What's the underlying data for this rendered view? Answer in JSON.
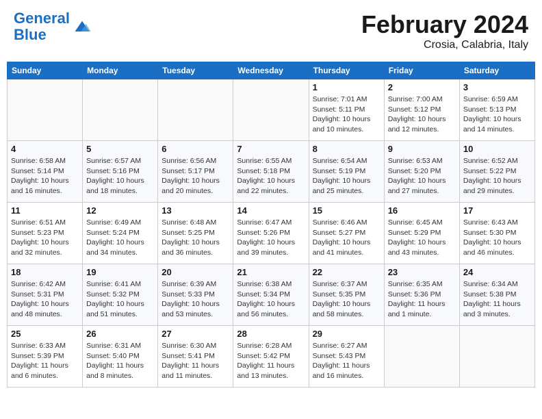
{
  "header": {
    "logo_line1": "General",
    "logo_line2": "Blue",
    "month": "February 2024",
    "location": "Crosia, Calabria, Italy"
  },
  "days_of_week": [
    "Sunday",
    "Monday",
    "Tuesday",
    "Wednesday",
    "Thursday",
    "Friday",
    "Saturday"
  ],
  "weeks": [
    [
      {
        "day": "",
        "info": ""
      },
      {
        "day": "",
        "info": ""
      },
      {
        "day": "",
        "info": ""
      },
      {
        "day": "",
        "info": ""
      },
      {
        "day": "1",
        "info": "Sunrise: 7:01 AM\nSunset: 5:11 PM\nDaylight: 10 hours\nand 10 minutes."
      },
      {
        "day": "2",
        "info": "Sunrise: 7:00 AM\nSunset: 5:12 PM\nDaylight: 10 hours\nand 12 minutes."
      },
      {
        "day": "3",
        "info": "Sunrise: 6:59 AM\nSunset: 5:13 PM\nDaylight: 10 hours\nand 14 minutes."
      }
    ],
    [
      {
        "day": "4",
        "info": "Sunrise: 6:58 AM\nSunset: 5:14 PM\nDaylight: 10 hours\nand 16 minutes."
      },
      {
        "day": "5",
        "info": "Sunrise: 6:57 AM\nSunset: 5:16 PM\nDaylight: 10 hours\nand 18 minutes."
      },
      {
        "day": "6",
        "info": "Sunrise: 6:56 AM\nSunset: 5:17 PM\nDaylight: 10 hours\nand 20 minutes."
      },
      {
        "day": "7",
        "info": "Sunrise: 6:55 AM\nSunset: 5:18 PM\nDaylight: 10 hours\nand 22 minutes."
      },
      {
        "day": "8",
        "info": "Sunrise: 6:54 AM\nSunset: 5:19 PM\nDaylight: 10 hours\nand 25 minutes."
      },
      {
        "day": "9",
        "info": "Sunrise: 6:53 AM\nSunset: 5:20 PM\nDaylight: 10 hours\nand 27 minutes."
      },
      {
        "day": "10",
        "info": "Sunrise: 6:52 AM\nSunset: 5:22 PM\nDaylight: 10 hours\nand 29 minutes."
      }
    ],
    [
      {
        "day": "11",
        "info": "Sunrise: 6:51 AM\nSunset: 5:23 PM\nDaylight: 10 hours\nand 32 minutes."
      },
      {
        "day": "12",
        "info": "Sunrise: 6:49 AM\nSunset: 5:24 PM\nDaylight: 10 hours\nand 34 minutes."
      },
      {
        "day": "13",
        "info": "Sunrise: 6:48 AM\nSunset: 5:25 PM\nDaylight: 10 hours\nand 36 minutes."
      },
      {
        "day": "14",
        "info": "Sunrise: 6:47 AM\nSunset: 5:26 PM\nDaylight: 10 hours\nand 39 minutes."
      },
      {
        "day": "15",
        "info": "Sunrise: 6:46 AM\nSunset: 5:27 PM\nDaylight: 10 hours\nand 41 minutes."
      },
      {
        "day": "16",
        "info": "Sunrise: 6:45 AM\nSunset: 5:29 PM\nDaylight: 10 hours\nand 43 minutes."
      },
      {
        "day": "17",
        "info": "Sunrise: 6:43 AM\nSunset: 5:30 PM\nDaylight: 10 hours\nand 46 minutes."
      }
    ],
    [
      {
        "day": "18",
        "info": "Sunrise: 6:42 AM\nSunset: 5:31 PM\nDaylight: 10 hours\nand 48 minutes."
      },
      {
        "day": "19",
        "info": "Sunrise: 6:41 AM\nSunset: 5:32 PM\nDaylight: 10 hours\nand 51 minutes."
      },
      {
        "day": "20",
        "info": "Sunrise: 6:39 AM\nSunset: 5:33 PM\nDaylight: 10 hours\nand 53 minutes."
      },
      {
        "day": "21",
        "info": "Sunrise: 6:38 AM\nSunset: 5:34 PM\nDaylight: 10 hours\nand 56 minutes."
      },
      {
        "day": "22",
        "info": "Sunrise: 6:37 AM\nSunset: 5:35 PM\nDaylight: 10 hours\nand 58 minutes."
      },
      {
        "day": "23",
        "info": "Sunrise: 6:35 AM\nSunset: 5:36 PM\nDaylight: 11 hours\nand 1 minute."
      },
      {
        "day": "24",
        "info": "Sunrise: 6:34 AM\nSunset: 5:38 PM\nDaylight: 11 hours\nand 3 minutes."
      }
    ],
    [
      {
        "day": "25",
        "info": "Sunrise: 6:33 AM\nSunset: 5:39 PM\nDaylight: 11 hours\nand 6 minutes."
      },
      {
        "day": "26",
        "info": "Sunrise: 6:31 AM\nSunset: 5:40 PM\nDaylight: 11 hours\nand 8 minutes."
      },
      {
        "day": "27",
        "info": "Sunrise: 6:30 AM\nSunset: 5:41 PM\nDaylight: 11 hours\nand 11 minutes."
      },
      {
        "day": "28",
        "info": "Sunrise: 6:28 AM\nSunset: 5:42 PM\nDaylight: 11 hours\nand 13 minutes."
      },
      {
        "day": "29",
        "info": "Sunrise: 6:27 AM\nSunset: 5:43 PM\nDaylight: 11 hours\nand 16 minutes."
      },
      {
        "day": "",
        "info": ""
      },
      {
        "day": "",
        "info": ""
      }
    ]
  ]
}
